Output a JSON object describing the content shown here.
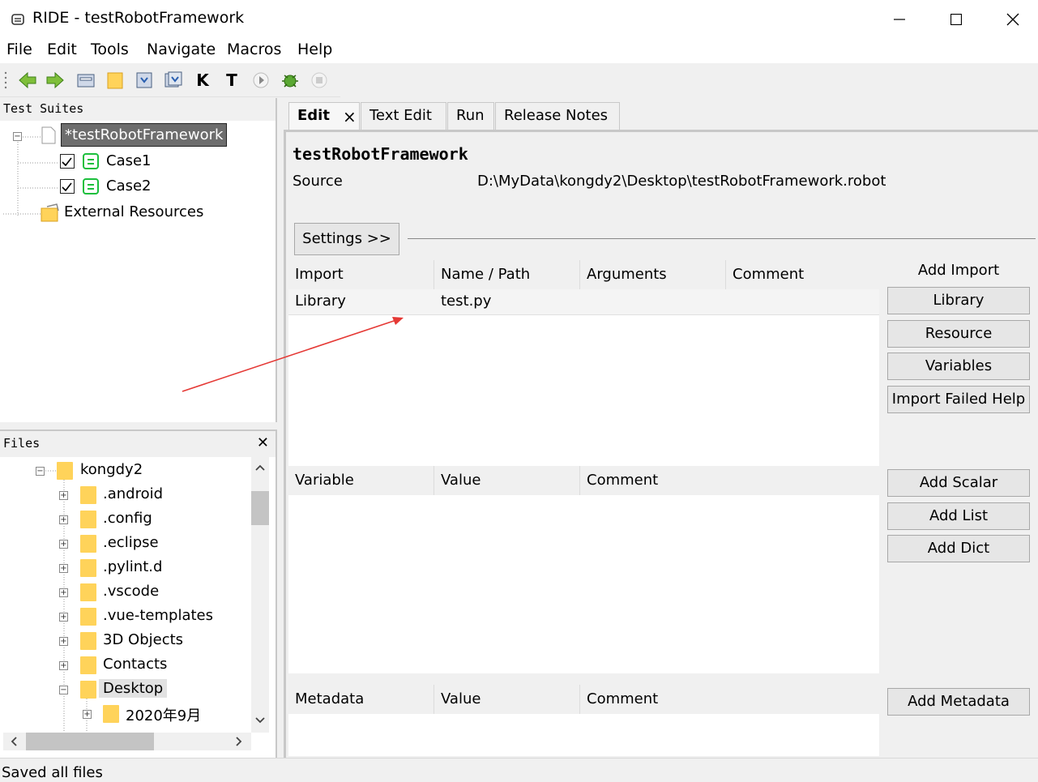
{
  "window": {
    "title": "RIDE - testRobotFramework"
  },
  "menu": [
    "File",
    "Edit",
    "Tools",
    "Navigate",
    "Macros",
    "Help"
  ],
  "toolbar": {
    "icons": [
      "back-arrow-icon",
      "forward-arrow-icon",
      "open-icon",
      "open-directory-icon",
      "save-icon",
      "save-all-icon",
      "search-keywords-icon",
      "search-tests-icon",
      "run-icon",
      "debug-icon",
      "stop-icon"
    ]
  },
  "suites": {
    "header": "Test Suites",
    "root": "*testRobotFramework",
    "cases": [
      "Case1",
      "Case2"
    ],
    "external": "External Resources"
  },
  "files": {
    "header": "Files",
    "close": "✕",
    "root": "kongdy2",
    "folders": [
      ".android",
      ".config",
      ".eclipse",
      ".pylint.d",
      ".vscode",
      ".vue-templates",
      "3D Objects",
      "Contacts",
      "Desktop"
    ],
    "child": "2020年9月"
  },
  "tabs": [
    {
      "label": "Edit",
      "active": true,
      "close": "×"
    },
    {
      "label": "Text Edit"
    },
    {
      "label": "Run"
    },
    {
      "label": "Release Notes"
    }
  ],
  "editor": {
    "suite_name": "testRobotFramework",
    "source_label": "Source",
    "source_path": "D:\\MyData\\kongdy2\\Desktop\\testRobotFramework.robot",
    "settings_button": "Settings >>",
    "import_grid": {
      "headers": [
        "Import",
        "Name / Path",
        "Arguments",
        "Comment"
      ],
      "rows": [
        [
          "Library",
          "test.py",
          "",
          ""
        ]
      ]
    },
    "add_import_label": "Add Import",
    "import_buttons": [
      "Library",
      "Resource",
      "Variables",
      "Import Failed Help"
    ],
    "variable_grid": {
      "headers": [
        "Variable",
        "Value",
        "Comment"
      ]
    },
    "variable_buttons": [
      "Add Scalar",
      "Add List",
      "Add Dict"
    ],
    "metadata_grid": {
      "headers": [
        "Metadata",
        "Value",
        "Comment"
      ]
    },
    "metadata_button": "Add Metadata"
  },
  "status": {
    "text": "Saved all files"
  },
  "colors": {
    "case_icon": "#1bbf3c",
    "folder": "#ffd35a",
    "annotation_arrow": "#e53935",
    "selected_bg": "#6d6d6d"
  }
}
